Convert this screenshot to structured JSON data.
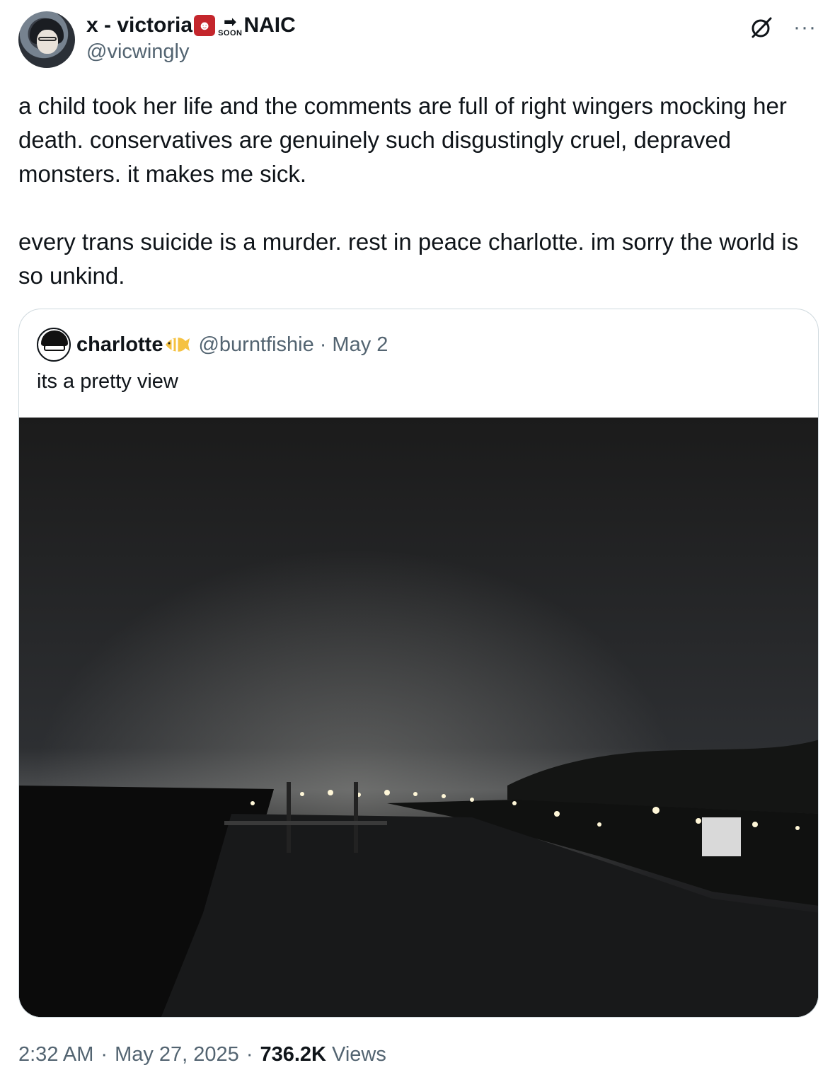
{
  "author": {
    "display_name_prefix": "x - victoria",
    "display_name_emoji": "ogre-emoji",
    "soon_badge": "SOON",
    "soon_arrow": "➡",
    "display_name_suffix": "NAIC",
    "handle": "@vicwingly"
  },
  "icons": {
    "grok": "grok-icon",
    "more": "more-icon",
    "fish": "tropical-fish-emoji"
  },
  "tweet": {
    "text": "a child took her life and the comments are full of right wingers mocking her death. conservatives are genuinely such disgustingly cruel, depraved monsters. it makes me sick.\n\nevery trans suicide is a murder. rest in peace charlotte. im sorry the world is so unkind."
  },
  "quote": {
    "name": "charlotte",
    "handle": "@burntfishie",
    "separator": "·",
    "date": "May 2",
    "text": "its a pretty view"
  },
  "meta": {
    "time": "2:32 AM",
    "dot": "·",
    "date": "May 27, 2025",
    "views_count": "736.2K",
    "views_label": "Views"
  }
}
